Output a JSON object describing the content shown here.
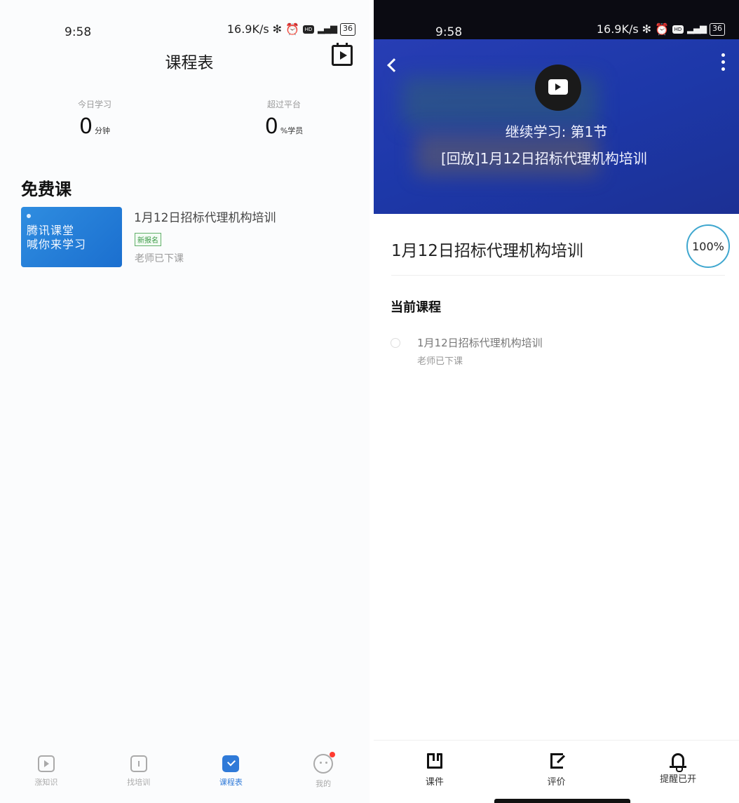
{
  "status_bar": {
    "time": "9:58",
    "speed": "16.9K/s",
    "battery": "36"
  },
  "left": {
    "title": "课程表",
    "stats": [
      {
        "label": "今日学习",
        "value": "0",
        "unit": "分钟"
      },
      {
        "label": "超过平台",
        "value": "0",
        "unit": "%学员"
      }
    ],
    "section_title": "免费课",
    "course": {
      "thumb_line1": "腾讯课堂",
      "thumb_line2": "喊你来学习",
      "title": "1月12日招标代理机构培训",
      "badge": "新报名",
      "status": "老师已下课"
    },
    "nav": [
      {
        "label": "涨知识",
        "icon": "play-square-icon",
        "active": false
      },
      {
        "label": "找培训",
        "icon": "book-icon",
        "active": false
      },
      {
        "label": "课程表",
        "icon": "check-square-icon",
        "active": true
      },
      {
        "label": "我的",
        "icon": "face-icon",
        "active": false
      }
    ]
  },
  "right": {
    "hero_line1": "继续学习: 第1节",
    "hero_line2": "[回放]1月12日招标代理机构培训",
    "course_title": "1月12日招标代理机构培训",
    "progress": "100%",
    "section_title": "当前课程",
    "lesson": {
      "title": "1月12日招标代理机构培训",
      "status": "老师已下课"
    },
    "nav": [
      {
        "label": "课件",
        "icon": "courseware-icon"
      },
      {
        "label": "评价",
        "icon": "edit-icon"
      },
      {
        "label": "提醒已开",
        "icon": "bell-icon"
      }
    ]
  },
  "colors": {
    "accent": "#2f7ad8",
    "hero": "#1d38a9",
    "progress_ring": "#3fa7cf",
    "badge": "#3c9a47"
  }
}
